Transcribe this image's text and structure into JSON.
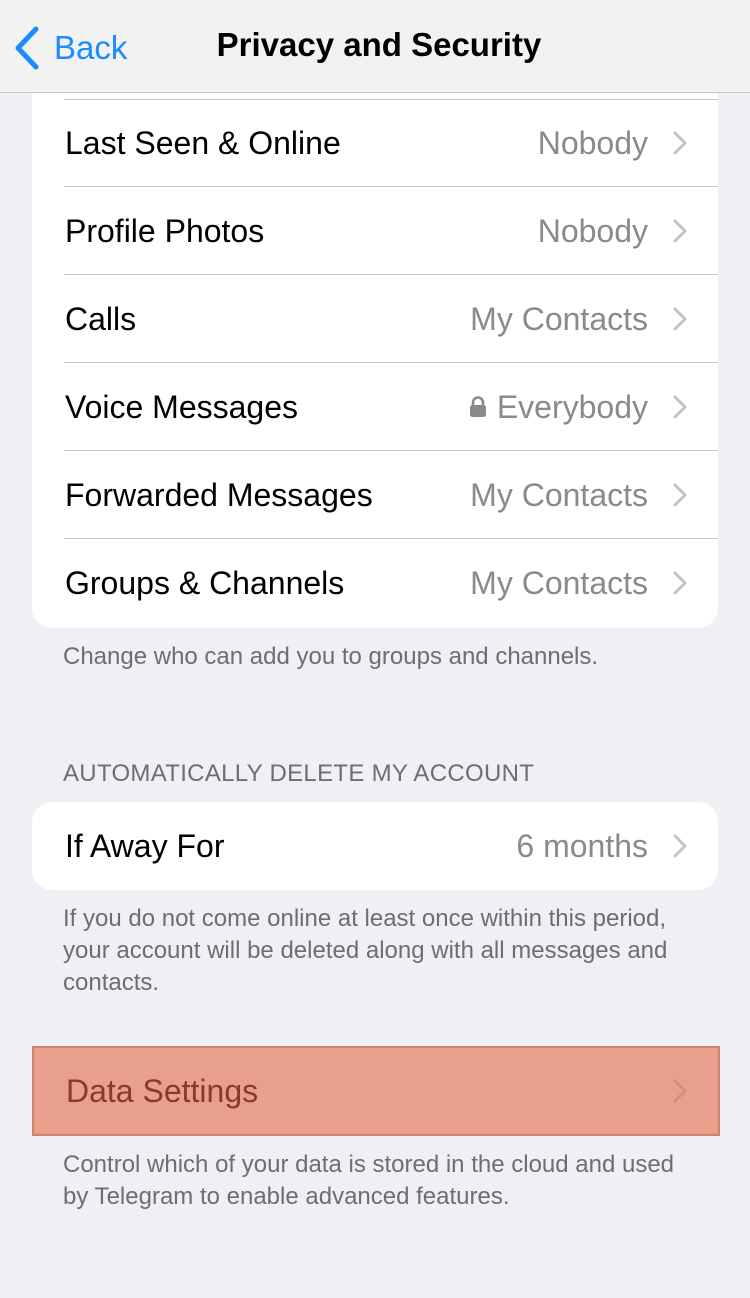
{
  "navbar": {
    "back_label": "Back",
    "title": "Privacy and Security"
  },
  "privacy_group": {
    "rows": [
      {
        "label": "Last Seen & Online",
        "value": "Nobody",
        "locked": false
      },
      {
        "label": "Profile Photos",
        "value": "Nobody",
        "locked": false
      },
      {
        "label": "Calls",
        "value": "My Contacts",
        "locked": false
      },
      {
        "label": "Voice Messages",
        "value": "Everybody",
        "locked": true
      },
      {
        "label": "Forwarded Messages",
        "value": "My Contacts",
        "locked": false
      },
      {
        "label": "Groups & Channels",
        "value": "My Contacts",
        "locked": false
      }
    ],
    "footer": "Change who can add you to groups and channels."
  },
  "delete_account": {
    "header": "AUTOMATICALLY DELETE MY ACCOUNT",
    "row": {
      "label": "If Away For",
      "value": "6 months"
    },
    "footer": "If you do not come online at least once within this period, your account will be deleted along with all messages and contacts."
  },
  "data_settings": {
    "label": "Data Settings",
    "footer": "Control which of your data is stored in the cloud and used by Telegram to enable advanced features.",
    "highlight_color": "#e8a08c"
  },
  "colors": {
    "accent": "#1a8cff",
    "background": "#efeff4",
    "secondary_text": "#8a8a8e"
  }
}
